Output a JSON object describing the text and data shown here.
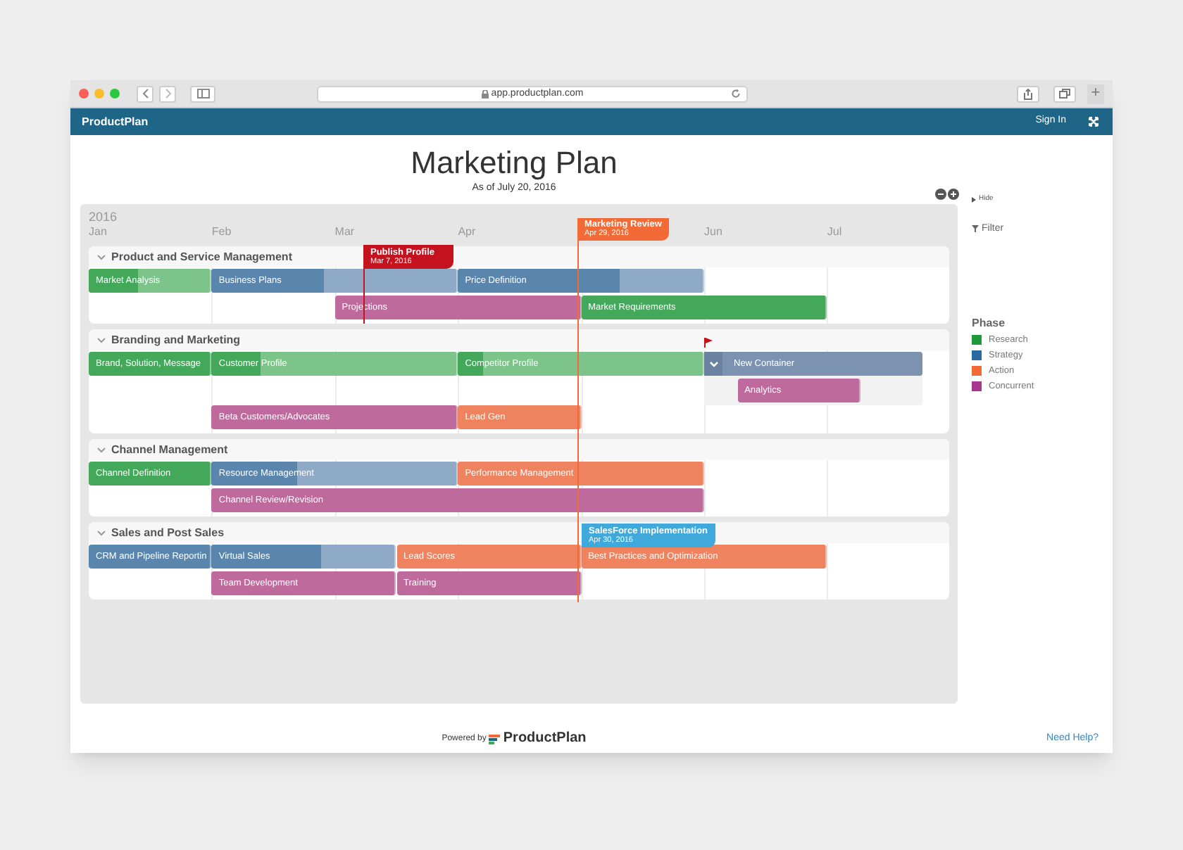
{
  "browser": {
    "url": "app.productplan.com",
    "new_tab": "+"
  },
  "app_bar": {
    "brand": "ProductPlan",
    "sign_in": "Sign In"
  },
  "plan": {
    "title": "Marketing Plan",
    "as_of": "As of July 20, 2016"
  },
  "timeline": {
    "year": "2016",
    "months": [
      "Jan",
      "Feb",
      "Mar",
      "Apr",
      "Jun",
      "Jul"
    ],
    "groups": [
      {
        "name": "Product and Service Management",
        "expanded": true,
        "bars": [
          {
            "name": "Market Analysis",
            "kind": "research",
            "level": 0.4
          },
          {
            "name": "Business Plans",
            "kind": "strategy",
            "level": 0.46
          },
          {
            "name": "Price Definition",
            "kind": "strategy",
            "level": 0.66
          },
          {
            "name": "Projections",
            "kind": "concurrent"
          },
          {
            "name": "Market Requirements",
            "kind": "research"
          }
        ]
      },
      {
        "name": "Branding and Marketing",
        "expanded": true,
        "bars": [
          {
            "name": "Brand, Solution, Message",
            "kind": "research"
          },
          {
            "name": "Customer Profile",
            "kind": "research",
            "level": 0.2
          },
          {
            "name": "Competitor Profile",
            "kind": "research",
            "level": 0.1
          },
          {
            "name": "New Container",
            "kind": "container",
            "expanded": true,
            "children": [
              {
                "name": "Analytics",
                "kind": "concurrent"
              }
            ]
          },
          {
            "name": "Beta Customers/Advocates",
            "kind": "concurrent"
          },
          {
            "name": "Lead Gen",
            "kind": "action"
          }
        ]
      },
      {
        "name": "Channel Management",
        "expanded": true,
        "bars": [
          {
            "name": "Channel Definition",
            "kind": "research"
          },
          {
            "name": "Resource Management",
            "kind": "strategy",
            "level": 0.35
          },
          {
            "name": "Performance Management",
            "kind": "action"
          },
          {
            "name": "Channel Review/Revision",
            "kind": "concurrent"
          }
        ]
      },
      {
        "name": "Sales and Post Sales",
        "expanded": true,
        "bars": [
          {
            "name": "CRM and Pipeline Reportin",
            "kind": "strategy"
          },
          {
            "name": "Virtual Sales",
            "kind": "strategy",
            "level": 0.6
          },
          {
            "name": "Lead Scores",
            "kind": "action"
          },
          {
            "name": "Best Practices and Optimization",
            "kind": "action"
          },
          {
            "name": "Team Development",
            "kind": "concurrent"
          },
          {
            "name": "Training",
            "kind": "concurrent"
          }
        ]
      }
    ],
    "milestones": [
      {
        "name": "Publish Profile",
        "date": "Mar 7, 2016",
        "color": "#c4121f"
      },
      {
        "name": "Marketing Review",
        "date": "Apr 29, 2016",
        "color": "#f26a36"
      },
      {
        "name": "SalesForce Implementation",
        "date": "Apr 30, 2016",
        "color": "#3fa9dc"
      }
    ]
  },
  "sidebar": {
    "hide": "Hide",
    "filter": "Filter",
    "legend_title": "Phase",
    "phases": [
      {
        "name": "Research",
        "color": "#1f9a3a"
      },
      {
        "name": "Strategy",
        "color": "#2b6aa0"
      },
      {
        "name": "Action",
        "color": "#f26a36"
      },
      {
        "name": "Concurrent",
        "color": "#a8378d"
      }
    ]
  },
  "footer": {
    "powered_by": "Powered by",
    "brand": "ProductPlan",
    "help": "Need Help?"
  }
}
